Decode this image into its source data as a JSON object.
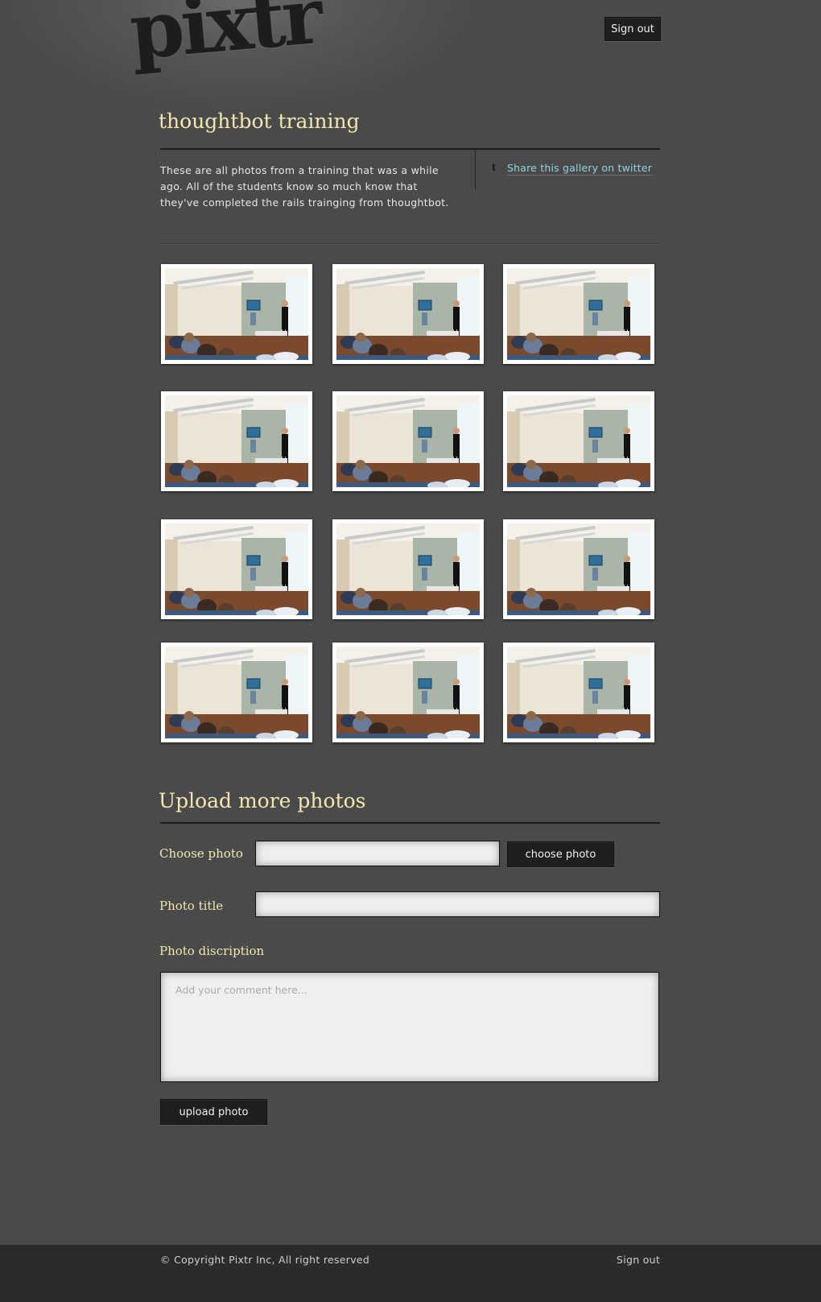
{
  "app": {
    "logo": "pixtr"
  },
  "header": {
    "sign_out": "Sign out"
  },
  "gallery": {
    "title": "thoughtbot training",
    "description": "These are all photos from a training that was a while ago. All of the students know so much know that they've completed the rails trainging from thoughtbot.",
    "share_link": "Share this gallery on twitter",
    "share_icon": "twitter-icon",
    "photo_count": 12
  },
  "upload": {
    "title": "Upload more photos",
    "choose_photo_label": "Choose photo",
    "choose_photo_button": "choose photo",
    "photo_title_label": "Photo title",
    "photo_title_value": "",
    "photo_description_label": "Photo discription",
    "photo_description_placeholder": "Add your comment here...",
    "submit_button": "upload photo"
  },
  "footer": {
    "copyright": "© Copyright Pixtr Inc, All right reserved",
    "sign_out": "Sign out"
  },
  "colors": {
    "background": "#4a4a4a",
    "heading": "#f2e7b0",
    "link": "#8fd4e2",
    "button": "#1f1f1f",
    "footer": "#2b2b2b"
  }
}
